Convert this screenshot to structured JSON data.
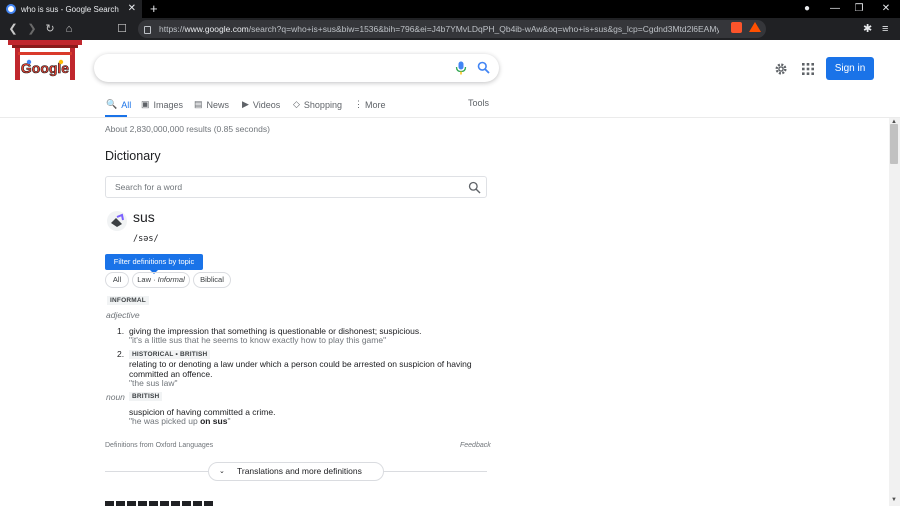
{
  "browser": {
    "tab_title": "who is sus - Google Search",
    "tab_close": "✕",
    "new_tab": "+",
    "url_host": "www.google.com",
    "url_prefix": "https://",
    "url_rest": "/search?q=who+is+sus&biw=1536&bih=796&ei=J4b7YMvLDqPH_Qb4ib-wAw&oq=who+is+sus&gs_lcp=Cgdnd3Mtd2l6EAMyA...",
    "nav_back": "❮",
    "nav_forward": "❯",
    "reload": "↻",
    "home": "⌂",
    "bookmark": "☐",
    "extensions": "✱",
    "menu": "≡",
    "profile": "●",
    "minimize": "—",
    "restore": "❐",
    "close": "✕"
  },
  "header": {
    "logo_text": "Google",
    "search_value": "",
    "sign_in": "Sign in",
    "icons": {
      "mic": "mic-icon",
      "search": "search-icon",
      "settings": "gear-icon",
      "apps": "apps-grid-icon"
    }
  },
  "tabs": [
    {
      "label": "All",
      "icon": "🔍"
    },
    {
      "label": "Images",
      "icon": "▣"
    },
    {
      "label": "News",
      "icon": "▤"
    },
    {
      "label": "Videos",
      "icon": "▶"
    },
    {
      "label": "Shopping",
      "icon": "◇"
    },
    {
      "label": "More",
      "icon": "⋮"
    }
  ],
  "tools_label": "Tools",
  "results_stats": "About 2,830,000,000 results (0.85 seconds)",
  "dictionary": {
    "title": "Dictionary",
    "search_placeholder": "Search for a word",
    "word": "sus",
    "phonetic": "/səs/",
    "filter_button": "Filter definitions by topic",
    "chips": [
      {
        "label": "All"
      },
      {
        "label": "Law · ",
        "italic": "Informal"
      },
      {
        "label": "Biblical"
      }
    ],
    "register_label": "INFORMAL",
    "entries": [
      {
        "pos": "adjective",
        "senses": [
          {
            "num": "1.",
            "definition": "giving the impression that something is questionable or dishonest; suspicious.",
            "example": "\"it's a little sus that he seems to know exactly how to play this game\""
          },
          {
            "num": "2.",
            "tags": "HISTORICAL • BRITISH",
            "definition": "relating to or denoting a law under which a person could be arrested on suspicion of having committed an offence.",
            "example": "\"the sus law\""
          }
        ]
      },
      {
        "pos": "noun",
        "tag": "BRITISH",
        "senses": [
          {
            "definition": "suspicion of having committed a crime.",
            "example_pre": "\"he was picked up ",
            "example_bold": "on sus",
            "example_post": "\""
          }
        ]
      }
    ],
    "source": "Definitions from Oxford Languages",
    "feedback": "Feedback",
    "more_button": "Translations and more definitions",
    "more_chevron": "⌄"
  },
  "colors": {
    "accent": "#1a73e8",
    "chrome_bg": "#202124",
    "text": "#202124",
    "muted": "#70757a"
  }
}
